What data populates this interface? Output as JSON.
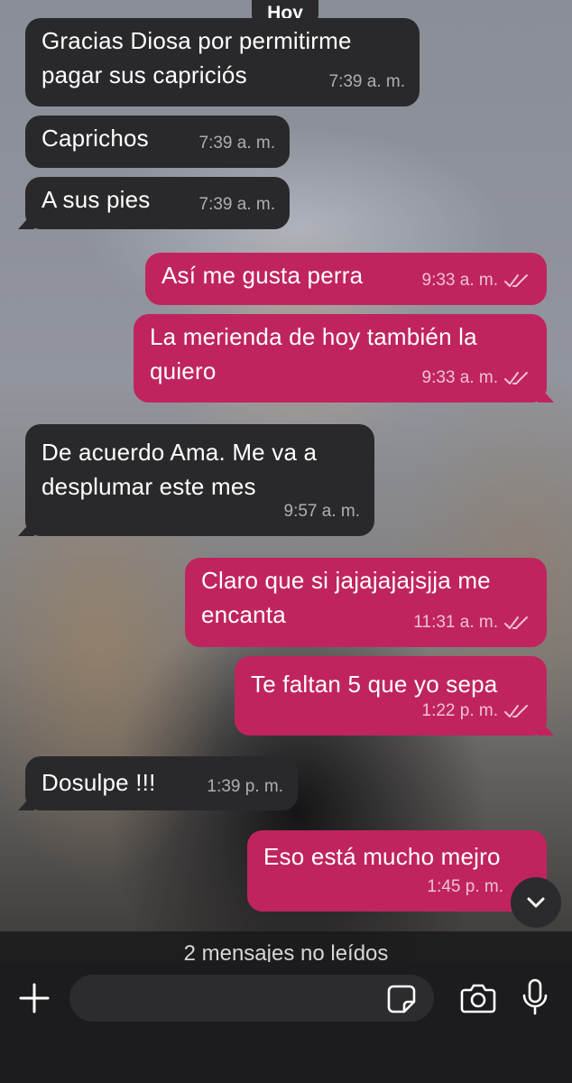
{
  "date_separator": "Hoy",
  "messages": [
    {
      "lines": [
        "Gracias Diosa por permitirme",
        "pagar sus capriciós"
      ],
      "time": "7:39 a. m."
    },
    {
      "lines": [
        "Caprichos"
      ],
      "time": "7:39 a. m."
    },
    {
      "lines": [
        "A sus pies"
      ],
      "time": "7:39 a. m."
    },
    {
      "lines": [
        "Así me gusta perra"
      ],
      "time": "9:33 a. m."
    },
    {
      "lines": [
        "La merienda de hoy también la",
        "quiero"
      ],
      "time": "9:33 a. m."
    },
    {
      "lines": [
        "De acuerdo Ama. Me va a",
        "desplumar este mes"
      ],
      "time": "9:57 a. m."
    },
    {
      "lines": [
        "Claro que si jajajajajsjja me",
        "encanta"
      ],
      "time": "11:31 a. m."
    },
    {
      "lines": [
        "Te faltan 5 que yo sepa"
      ],
      "time": "1:22 p. m."
    },
    {
      "lines": [
        "Dosulpe !!!"
      ],
      "time": "1:39 p. m."
    },
    {
      "lines": [
        "Eso está mucho mejro"
      ],
      "time": "1:45 p. m."
    }
  ],
  "unread_banner": "2 mensajes no leídos",
  "composer": {
    "value": "",
    "placeholder": ""
  },
  "icons": {
    "add": "plus-icon",
    "sticker": "sticker-icon",
    "camera": "camera-icon",
    "mic": "microphone-icon",
    "scroll": "chevron-down-icon",
    "read_receipt": "double-check-icon"
  },
  "colors": {
    "incoming_bubble": "#29292b",
    "outgoing_bubble": "#c0245e",
    "input_bar": "#1c1c1e"
  }
}
